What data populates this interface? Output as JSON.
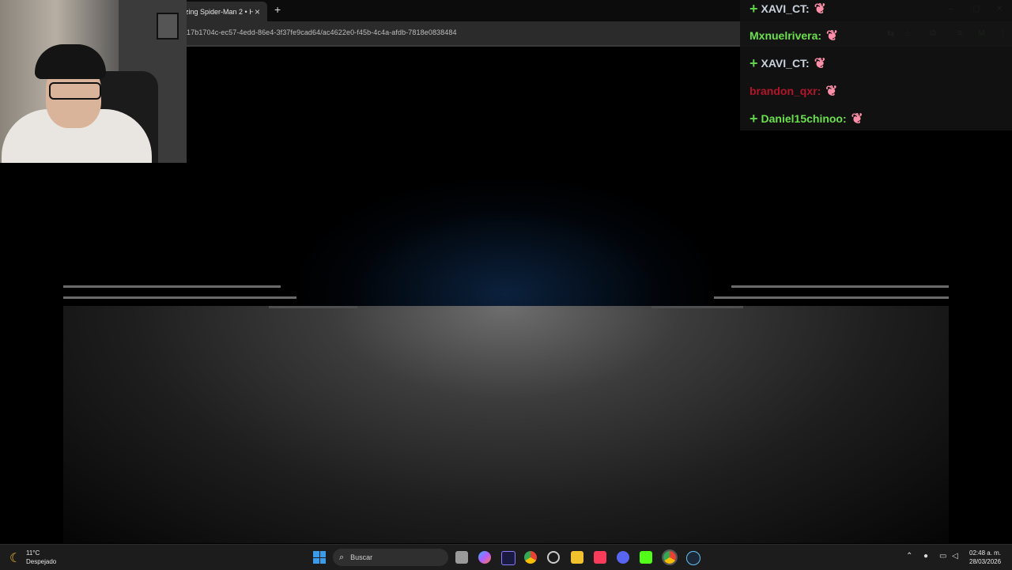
{
  "browser": {
    "tab_title": "zing Spider-Man 2 • H",
    "tab_close": "×",
    "new_tab": "+",
    "url": "17b1704c-ec57-4edd-86e4-3f37fe9cad64/ac4622e0-f45b-4c4a-afdb-7818e0838484",
    "window_controls": [
      "–",
      "▢",
      "✕"
    ]
  },
  "chat": {
    "messages": [
      {
        "user": "XAVI_CT:",
        "badge": "+",
        "color": "grey"
      },
      {
        "user": "Mxnuelrivera:",
        "badge": "",
        "color": "green"
      },
      {
        "user": "XAVI_CT:",
        "badge": "+",
        "color": "grey"
      },
      {
        "user": "brandon_qxr:",
        "badge": "",
        "color": "red"
      },
      {
        "user": "Daniel15chinoo:",
        "badge": "+",
        "color": "green"
      }
    ],
    "emote_icon": "hands-emote-icon"
  },
  "taskbar": {
    "temperature": "11°C",
    "condition": "Despejado",
    "search_placeholder": "Buscar",
    "time": "02:48 a. m.",
    "date": "28/03/2026"
  },
  "colors": {
    "chat_green": "#6ae04a",
    "chat_grey": "#c9d2dc",
    "chat_red": "#b3152a",
    "taskbar_bg": "#1c1c1c"
  }
}
